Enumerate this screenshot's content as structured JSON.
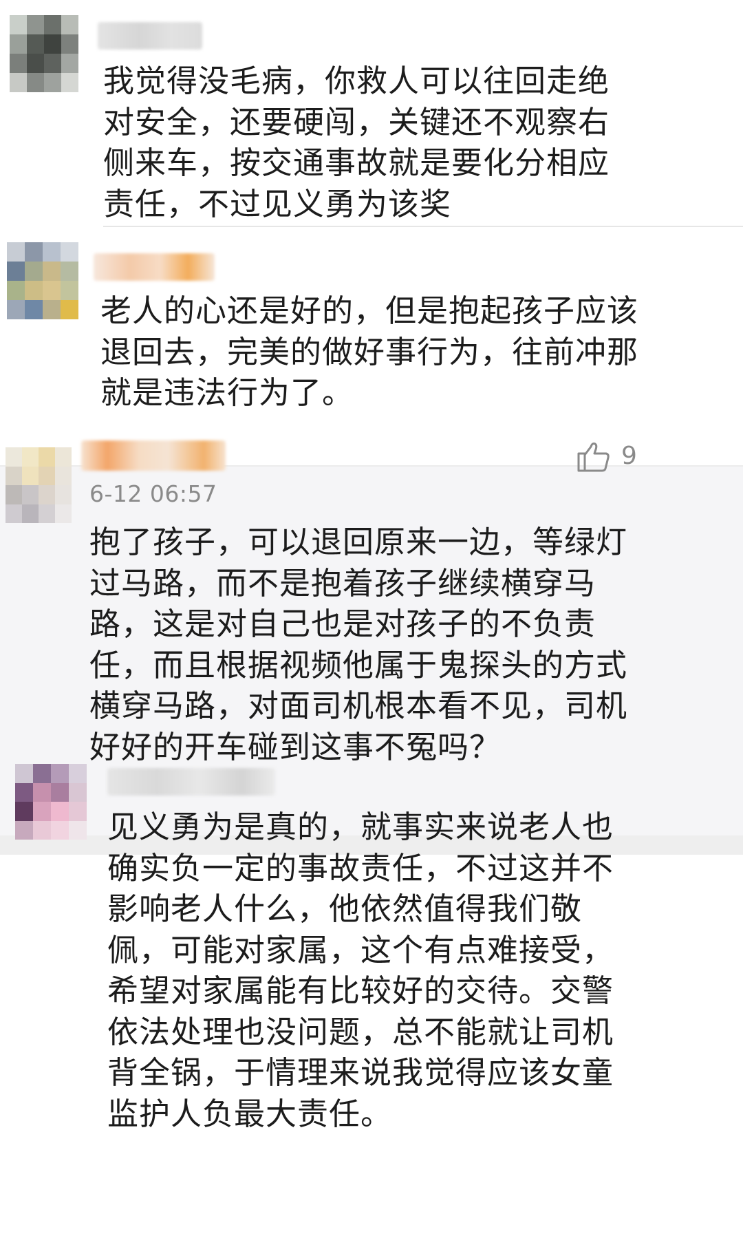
{
  "comments": [
    {
      "text": "我觉得没毛病，你救人可以往回走绝对安全，还要硬闯，关键还不观察右侧来车，按交通事故就是要化分相应责任，不过见义勇为该奖"
    },
    {
      "text": "老人的心还是好的，但是抱起孩子应该退回去，完美的做好事行为，往前冲那就是违法行为了。"
    },
    {
      "time": "6-12 06:57",
      "likes": "9",
      "text": "抱了孩子，可以退回原来一边，等绿灯过马路，而不是抱着孩子继续横穿马路，这是对自己也是对孩子的不负责任，而且根据视频他属于鬼探头的方式横穿马路，对面司机根本看不见，司机好好的开车碰到这事不冤吗？"
    },
    {
      "text": "见义勇为是真的，就事实来说老人也确实负一定的事故责任，不过这并不影响老人什么，他依然值得我们敬佩，可能对家属，这个有点难接受，希望对家属能有比较好的交待。交警依法处理也没问题，总不能就让司机背全锅，于情理来说我觉得应该女童监护人负最大责任。"
    }
  ],
  "icons": {
    "like": "thumbs-up-icon"
  },
  "colors": {
    "highlight_bg": "#f5f5f7",
    "meta_text": "#8a8a8a"
  }
}
